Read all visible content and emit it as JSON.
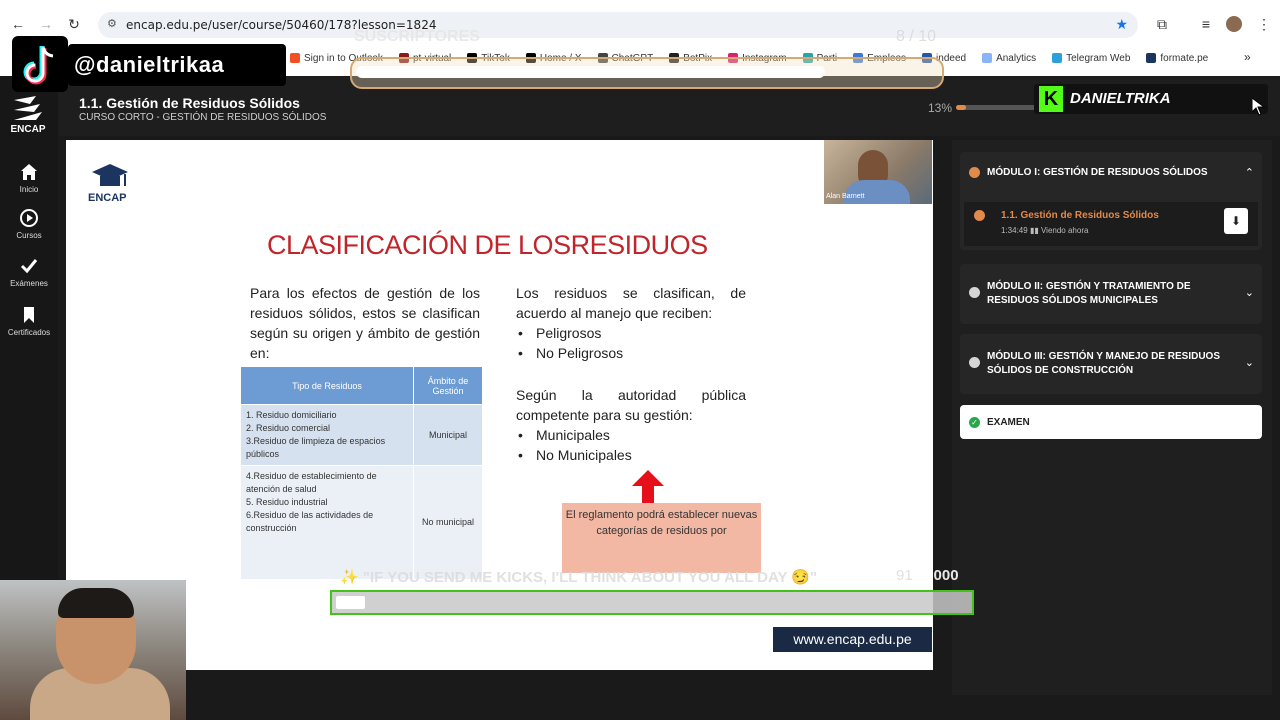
{
  "browser": {
    "url": "encap.edu.pe/user/course/50460/178?lesson=1824",
    "bookmarks": [
      {
        "label": "Sign in to Outlook",
        "icon": "windows-icon",
        "color": "#f25022"
      },
      {
        "label": "pt-virtual",
        "icon": "bookmark-icon",
        "color": "#8b1a1a"
      },
      {
        "label": "TikTok",
        "icon": "tiktok-icon",
        "color": "#000000"
      },
      {
        "label": "Home / X",
        "icon": "x-icon",
        "color": "#000000"
      },
      {
        "label": "ChatGPT",
        "icon": "chatgpt-icon",
        "color": "#444444"
      },
      {
        "label": "BotPix",
        "icon": "bot-icon",
        "color": "#222222"
      },
      {
        "label": "Instagram",
        "icon": "instagram-icon",
        "color": "#d6246e"
      },
      {
        "label": "Parti",
        "icon": "bookmark-icon",
        "color": "#2aa3a3"
      },
      {
        "label": "Empleos",
        "icon": "bookmark-icon",
        "color": "#3a7bd5"
      },
      {
        "label": "indeed",
        "icon": "indeed-icon",
        "color": "#2557a7"
      },
      {
        "label": "Analytics",
        "icon": "analytics-icon",
        "color": "#8ab4f8"
      },
      {
        "label": "Telegram Web",
        "icon": "telegram-icon",
        "color": "#2aa1da"
      },
      {
        "label": "formate.pe",
        "icon": "bookmark-icon",
        "color": "#1c3560"
      }
    ],
    "more_bookmarks": "»"
  },
  "header": {
    "title": "1.1. Gestión de Residuos Sólidos",
    "subtitle": "CURSO CORTO - GESTIÓN DE RESIDUOS SÓLIDOS",
    "progress_label": "13%",
    "progress_value": 0.13
  },
  "sidebar": {
    "logo": "ENCAP",
    "items": [
      {
        "label": "Inicio",
        "icon": "home-icon"
      },
      {
        "label": "Cursos",
        "icon": "play-circle-icon"
      },
      {
        "label": "Exámenes",
        "icon": "check-icon"
      },
      {
        "label": "Certificados",
        "icon": "bookmark-icon"
      }
    ]
  },
  "slide": {
    "logo": "ENCAP",
    "presenter": "Alan Barnett",
    "title": "CLASIFICACIÓN DE LOSRESIDUOS",
    "left_text": "Para los efectos de gestión de los residuos sólidos, estos se clasifican según su origen y ámbito de gestión en:",
    "right_intro": "Los residuos se clasifican, de acuerdo al manejo que reciben:",
    "right_bullets_1": [
      "Peligrosos",
      "No Peligrosos"
    ],
    "right_intro_2": "Según la autoridad pública competente para su gestión:",
    "right_bullets_2": [
      "Municipales",
      "No Municipales"
    ],
    "table": {
      "headers": [
        "Tipo de Residuos",
        "Ámbito de Gestión"
      ],
      "rows": [
        {
          "items": "1. Residuo domiciliario\n2. Residuo comercial\n3.Residuo de limpieza de espacios públicos",
          "scope": "Municipal"
        },
        {
          "items": "4.Residuo de establecimiento de atención de salud\n5. Residuo industrial\n6.Residuo de las actividades de construcción",
          "scope": "No municipal"
        }
      ]
    },
    "note": "El reglamento podrá establecer nuevas categorías de residuos por",
    "website": "www.encap.edu.pe"
  },
  "modules": [
    {
      "title": "MÓDULO I: GESTIÓN DE RESIDUOS SÓLIDOS",
      "expanded": true,
      "status_color": "#e28a4a",
      "lessons": [
        {
          "title": "1.1. Gestión de Residuos Sólidos",
          "duration": "1:34:49",
          "status": "Viendo ahora"
        }
      ]
    },
    {
      "title": "MÓDULO II: GESTIÓN Y TRATAMIENTO DE RESIDUOS SÓLIDOS MUNICIPALES",
      "expanded": false
    },
    {
      "title": "MÓDULO III: GESTIÓN Y MANEJO DE RESIDUOS SÓLIDOS DE CONSTRUCCIÓN",
      "expanded": false
    }
  ],
  "exam": {
    "label": "EXAMEN"
  },
  "overlays": {
    "tiktok_handle": "@danieltrikaa",
    "subscribers_label": "SUSCRIPTORES",
    "subscribers_count": "8",
    "subscribers_goal": "/ 10",
    "subscribers_progress": 0.8,
    "kick_name": "DANIELTRIKA",
    "kick_message": "\"IF YOU SEND ME KICKS, I'LL THINK ABOUT YOU ALL DAY 😏\"",
    "kick_count": "91",
    "kick_goal": "/ 2000",
    "kick_progress": 0.045
  }
}
